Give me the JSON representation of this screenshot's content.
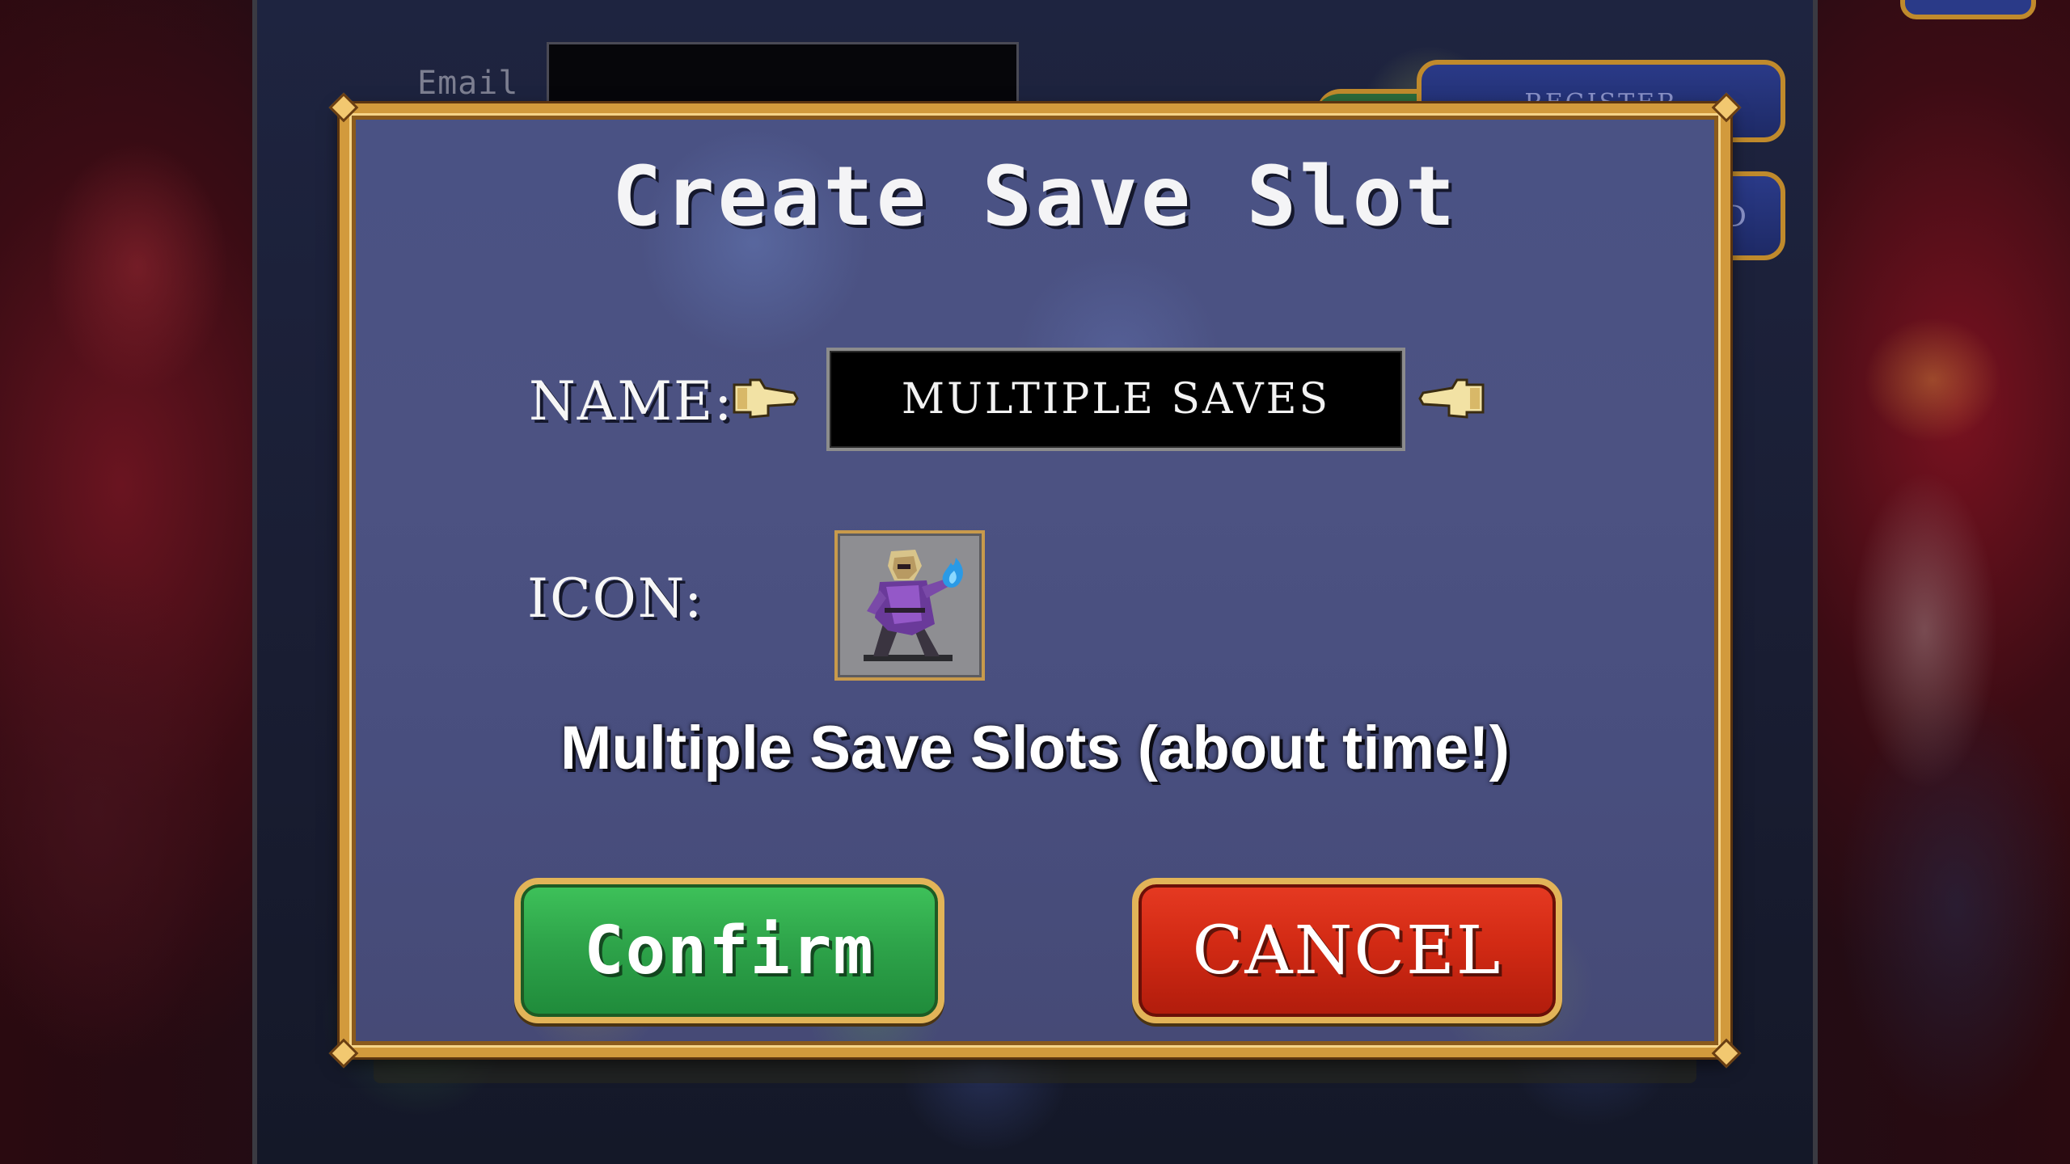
{
  "background": {
    "email_label": "Email",
    "register_button_label": "REGISTER",
    "partial_button_label": "D"
  },
  "dialog": {
    "title": "Create Save Slot",
    "name_label": "NAME:",
    "name_value": "MULTIPLE SAVES",
    "icon_label": "ICON:",
    "icon_name": "purple-hooded-mage-holding-blue-flame",
    "caption": "Multiple Save Slots (about time!)",
    "confirm_label": "Confirm",
    "cancel_label": "CANCEL"
  },
  "colors": {
    "frame_gold": "#d29a3c",
    "confirm_green": "#2ea44a",
    "cancel_red": "#d22a14",
    "dialog_blue": "#4a5284"
  }
}
